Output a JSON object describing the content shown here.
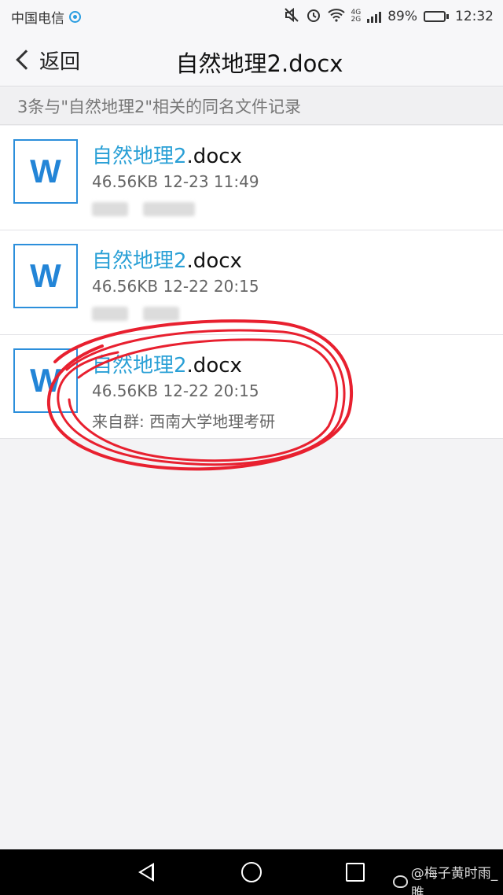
{
  "status_bar": {
    "carrier": "中国电信",
    "net_type_top": "4G",
    "net_type_bottom": "2G",
    "battery": "89%",
    "battery_level": 0.89,
    "time": "12:32"
  },
  "nav": {
    "back_label": "返回",
    "title": "自然地理2.docx"
  },
  "results": {
    "header": "3条与\"自然地理2\"相关的同名文件记录",
    "files": [
      {
        "icon_letter": "W",
        "name_highlight": "自然地理2",
        "name_ext": ".docx",
        "meta": "46.56KB 12-23 11:49",
        "source": ""
      },
      {
        "icon_letter": "W",
        "name_highlight": "自然地理2",
        "name_ext": ".docx",
        "meta": "46.56KB 12-22 20:15",
        "source": ""
      },
      {
        "icon_letter": "W",
        "name_highlight": "自然地理2",
        "name_ext": ".docx",
        "meta": "46.56KB 12-22 20:15",
        "source": "来自群: 西南大学地理考研"
      }
    ]
  },
  "watermark": "@梅子黄时雨_雎",
  "colors": {
    "accent": "#2aa0d6",
    "word_icon": "#2385d7",
    "annotation": "#e8202f"
  },
  "icons": {
    "mute": "mute-icon",
    "alarm": "alarm-icon",
    "wifi": "wifi-icon",
    "signal": "signal-icon",
    "battery": "battery-icon",
    "back": "chevron-left-icon",
    "file": "word-doc-icon"
  }
}
